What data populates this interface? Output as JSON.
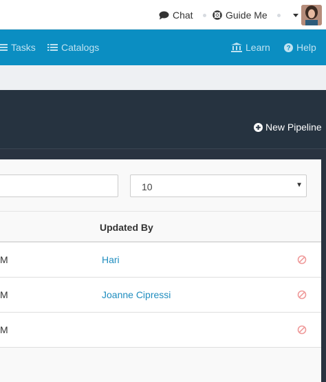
{
  "topbar": {
    "chat_label": "Chat",
    "guide_label": "Guide Me"
  },
  "navbar": {
    "tasks_label": "Tasks",
    "catalogs_label": "Catalogs",
    "learn_label": "Learn",
    "help_label": "Help"
  },
  "header": {
    "new_pipeline_label": "New Pipeline"
  },
  "filters": {
    "search_value": "",
    "page_size": "10"
  },
  "table": {
    "columns": {
      "updated_by": "Updated By"
    },
    "rows": [
      {
        "updated_tail": "M",
        "updated_by": "Hari"
      },
      {
        "updated_tail": "M",
        "updated_by": "Joanne Cipressi"
      },
      {
        "updated_tail": "M",
        "updated_by": ""
      }
    ]
  },
  "colors": {
    "nav_blue": "#0b8ec2",
    "header_dark": "#263340",
    "link_blue": "#1f8dbf",
    "delete_red": "#ef9a9a"
  }
}
